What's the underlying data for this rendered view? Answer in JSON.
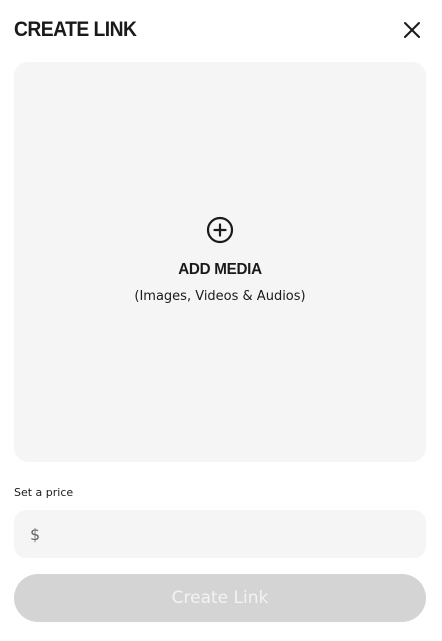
{
  "modal": {
    "title": "CREATE LINK",
    "close_icon": "close-icon"
  },
  "media": {
    "icon": "plus-circle-icon",
    "title": "ADD MEDIA",
    "subtitle": "(Images, Videos & Audios)"
  },
  "price": {
    "label": "Set a price",
    "currency_symbol": "$",
    "value": "",
    "placeholder": ""
  },
  "submit": {
    "label": "Create Link",
    "state": "disabled"
  },
  "colors": {
    "text": "#1a1a1a",
    "surface": "#f5f5f5",
    "button_disabled_bg": "#d4d4d4",
    "button_disabled_text": "#f3f3f3"
  }
}
